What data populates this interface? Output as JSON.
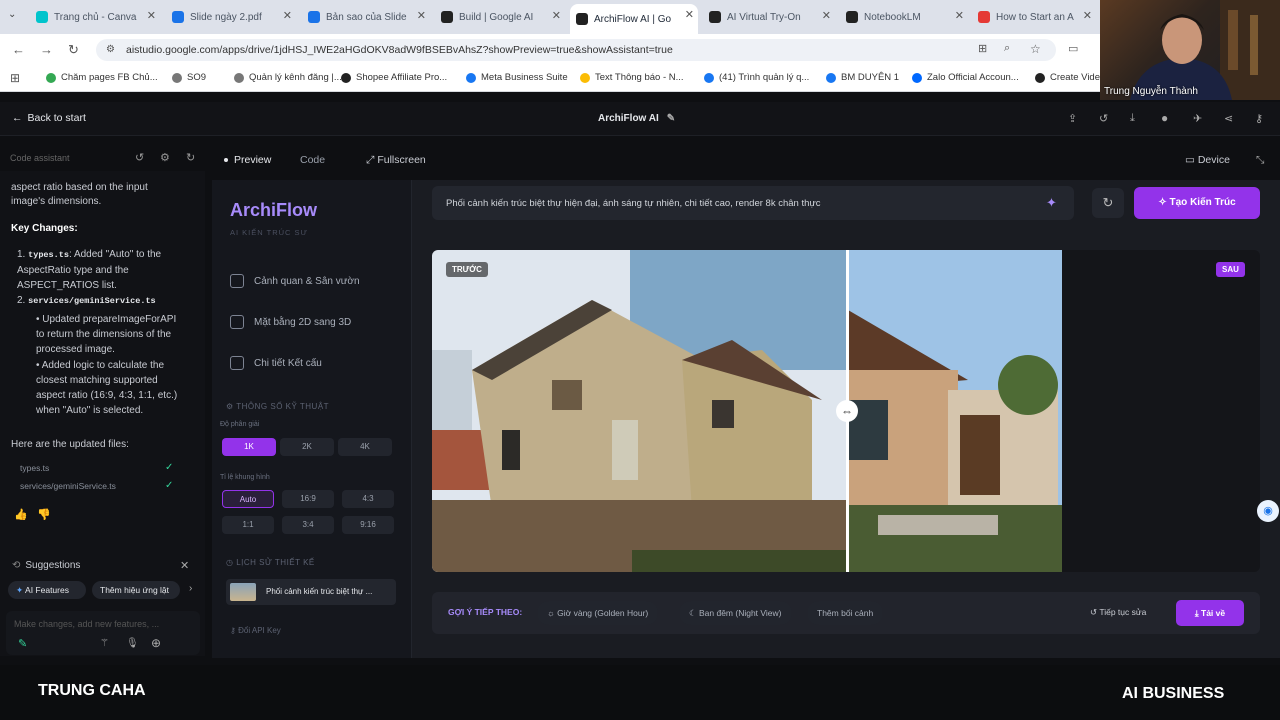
{
  "browser": {
    "tabs": [
      {
        "label": "Trang chủ - Canva",
        "color": "#00c4cc"
      },
      {
        "label": "Slide ngày 2.pdf",
        "color": "#1a73e8"
      },
      {
        "label": "Bản sao của Slide",
        "color": "#1a73e8"
      },
      {
        "label": "Build | Google AI",
        "color": "#222222"
      },
      {
        "label": "ArchiFlow AI | Go",
        "color": "#222222"
      },
      {
        "label": "AI Virtual Try-On",
        "color": "#222222"
      },
      {
        "label": "NotebookLM",
        "color": "#222222"
      },
      {
        "label": "How to Start an A",
        "color": "#e53935"
      }
    ],
    "url": "aistudio.google.com/apps/drive/1jdHSJ_IWE2aHGdOKV8adW9fBSEBvAhsZ?showPreview=true&showAssistant=true",
    "bookmarks": [
      {
        "label": "Chăm pages FB Chủ...",
        "color": "#34a853"
      },
      {
        "label": "SO9",
        "color": "#777777"
      },
      {
        "label": "Quản lý kênh đăng |...",
        "color": "#777777"
      },
      {
        "label": "Shopee Affiliate Pro...",
        "color": "#222222"
      },
      {
        "label": "Meta Business Suite",
        "color": "#1877f2"
      },
      {
        "label": "Text Thông báo - N...",
        "color": "#fbbc04"
      },
      {
        "label": "(41) Trình quản lý q...",
        "color": "#1877f2"
      },
      {
        "label": "BM DUYÊN 1",
        "color": "#1877f2"
      },
      {
        "label": "Zalo Official Accoun...",
        "color": "#0068ff"
      },
      {
        "label": "Create Vide",
        "color": "#222222"
      }
    ]
  },
  "webcam": {
    "name": "Trung Nguyễn Thành"
  },
  "app_header": {
    "back": "Back to start",
    "title": "ArchiFlow AI"
  },
  "assistant": {
    "label": "Code assistant",
    "intro": "aspect ratio based on the input image's dimensions.",
    "key_changes": "Key Changes:",
    "item1_file": "types.ts",
    "item1_text": ": Added \"Auto\" to the AspectRatio type and the ASPECT_RATIOS list.",
    "item2_file": "services/geminiService.ts",
    "sub1": "Updated prepareImageForAPI to return the dimensions of the processed image.",
    "sub2": "Added logic to calculate the closest matching supported aspect ratio (16:9, 4:3, 1:1, etc.) when \"Auto\" is selected.",
    "updated": "Here are the updated files:",
    "files": [
      "types.ts",
      "services/geminiService.ts"
    ],
    "suggestions": "Suggestions",
    "chips": [
      "AI Features",
      "Thêm hiệu ứng lật"
    ],
    "input_placeholder": "Make changes, add new features, ..."
  },
  "preview_bar": {
    "preview": "Preview",
    "code": "Code",
    "fullscreen": "Fullscreen",
    "device": "Device"
  },
  "archiflow": {
    "brand": "ArchiFlow",
    "subtitle": "AI KIẾN TRÚC SƯ",
    "nav": [
      "Cảnh quan & Sân vườn",
      "Mặt bằng 2D sang 3D",
      "Chi tiết Kết cấu"
    ],
    "tech_title": "THÔNG SỐ KỸ THUẬT",
    "resolution_label": "Độ phân giải",
    "resolutions": [
      "1K",
      "2K",
      "4K"
    ],
    "ratio_label": "Tỉ lệ khung hình",
    "ratios": [
      "Auto",
      "16:9",
      "4:3",
      "1:1",
      "3:4",
      "9:16"
    ],
    "history_title": "LỊCH SỬ THIẾT KẾ",
    "history_item": "Phối cảnh kiến trúc biệt thự ...",
    "api_key": "Đổi API Key"
  },
  "prompt": {
    "text": "Phối cảnh kiến trúc biệt thự hiện đại, ánh sáng tự nhiên, chi tiết cao, render 8k chân thực",
    "generate": "Tạo Kiến Trúc"
  },
  "compare": {
    "before": "TRƯỚC",
    "after": "SAU"
  },
  "next": {
    "label": "GỢI Ý TIẾP THEO:",
    "chips": [
      "Giờ vàng (Golden Hour)",
      "Ban đêm (Night View)",
      "Thêm bối cảnh"
    ],
    "continue": "Tiếp tục sửa",
    "download": "Tải về"
  },
  "footer": {
    "left": "TRUNG CAHA",
    "right": "AI BUSINESS"
  }
}
